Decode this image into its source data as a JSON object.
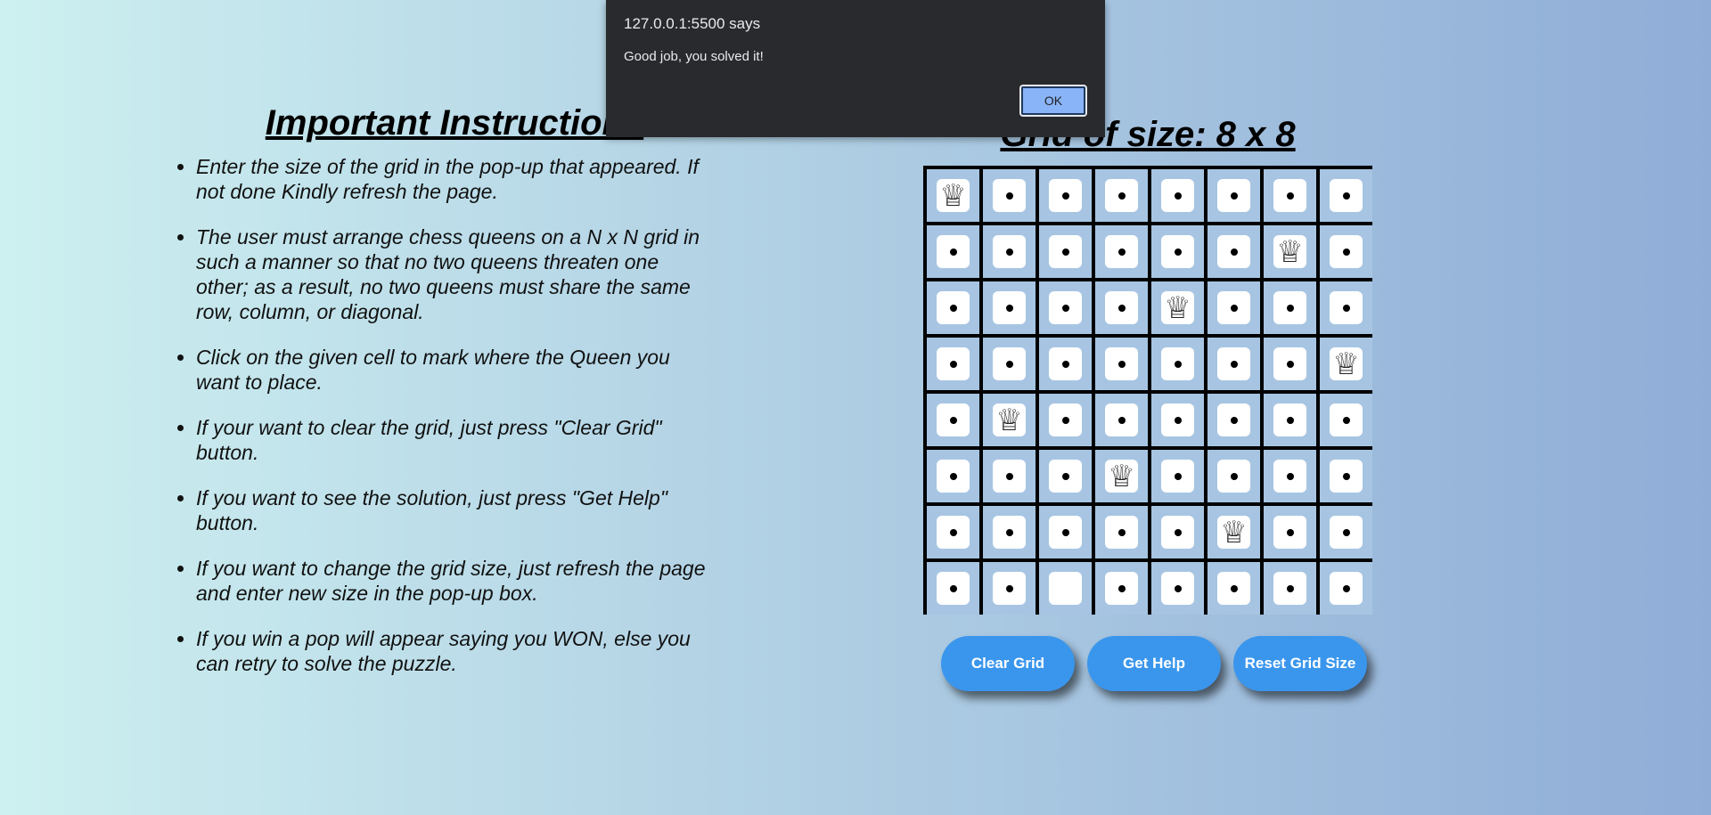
{
  "instructions": {
    "title": "Important Instructions",
    "items": [
      "Enter the size of the grid in the pop-up that appeared. If not done Kindly refresh the page.",
      "The user must arrange chess queens on a N x N grid in such a manner so that no two queens threaten one other; as a result, no two queens must share the same row, column, or diagonal.",
      "Click on the given cell to mark where the Queen you want to place.",
      "If your want to clear the grid, just press \"Clear Grid\" button.",
      "If you want to see the solution, just press \"Get Help\" button.",
      "If you want to change the grid size, just refresh the page and enter new size in the pop-up box.",
      "If you win a pop will appear saying you WON, else you can retry to solve the puzzle."
    ]
  },
  "grid": {
    "title": "Grid of size: 8 x 8",
    "size": 8,
    "queens": [
      [
        0,
        0
      ],
      [
        1,
        6
      ],
      [
        2,
        4
      ],
      [
        3,
        7
      ],
      [
        4,
        1
      ],
      [
        5,
        3
      ],
      [
        6,
        5
      ]
    ],
    "empty": [
      [
        7,
        2
      ]
    ]
  },
  "buttons": {
    "clear": "Clear Grid",
    "help": "Get Help",
    "reset": "Reset Grid Size"
  },
  "dialog": {
    "title": "127.0.0.1:5500 says",
    "message": "Good job, you solved it!",
    "ok": "OK"
  },
  "icons": {
    "queen": "queen-icon",
    "dot": "dot-icon"
  },
  "colors": {
    "button": "#3a96ec",
    "cell": "#a7c5e2",
    "dialog_bg": "#292a2d",
    "ok_button": "#8ab4f8"
  }
}
